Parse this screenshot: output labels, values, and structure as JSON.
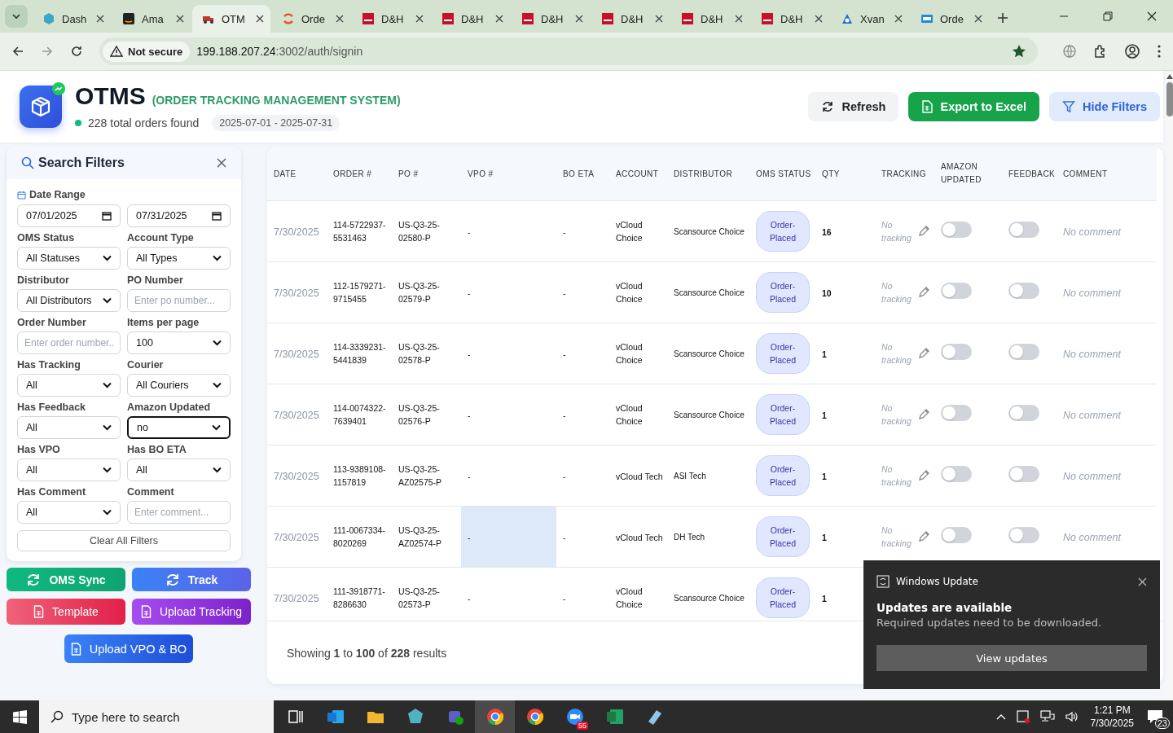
{
  "browser": {
    "tabs": [
      {
        "title": "Dash",
        "kind": "hex",
        "selected": false
      },
      {
        "title": "Ama",
        "kind": "amazon",
        "selected": false
      },
      {
        "title": "OTM",
        "kind": "truck",
        "selected": true
      },
      {
        "title": "Orde",
        "kind": "swirl",
        "selected": false
      },
      {
        "title": "D&H",
        "kind": "dh",
        "selected": false
      },
      {
        "title": "D&H",
        "kind": "dh",
        "selected": false
      },
      {
        "title": "D&H",
        "kind": "dh",
        "selected": false
      },
      {
        "title": "D&H",
        "kind": "dh",
        "selected": false
      },
      {
        "title": "D&H",
        "kind": "dh",
        "selected": false
      },
      {
        "title": "D&H",
        "kind": "dh",
        "selected": false
      },
      {
        "title": "Xvan",
        "kind": "xvan",
        "selected": false
      },
      {
        "title": "Orde",
        "kind": "ec",
        "selected": false
      }
    ],
    "security": "Not secure",
    "url_host": "199.188.207.24",
    "url_path": ":3002/auth/signin",
    "bookmarked": true
  },
  "header": {
    "title": "OTMS",
    "subtitle": "(ORDER TRACKING MANAGEMENT SYSTEM)",
    "count_text": "228 total orders found",
    "date_range": "2025-07-01 - 2025-07-31",
    "buttons": [
      {
        "label": "Refresh",
        "kind": "refresh"
      },
      {
        "label": "Export to Excel",
        "kind": "export"
      },
      {
        "label": "Hide Filters",
        "kind": "filter"
      }
    ]
  },
  "filters": {
    "title": "Search Filters",
    "date_label": "Date Range",
    "date_from": "07/01/2025",
    "date_to": "07/31/2025",
    "fields": [
      {
        "label": "OMS Status",
        "kind": "select",
        "value": "All Statuses",
        "focused": false
      },
      {
        "label": "Account Type",
        "kind": "select",
        "value": "All Types",
        "focused": false
      },
      {
        "label": "Distributor",
        "kind": "select",
        "value": "All Distributors",
        "focused": false
      },
      {
        "label": "PO Number",
        "kind": "text",
        "placeholder": "Enter po number...",
        "focused": false
      },
      {
        "label": "Order Number",
        "kind": "text",
        "placeholder": "Enter order number..",
        "focused": false
      },
      {
        "label": "Items per page",
        "kind": "select",
        "value": "100",
        "focused": false
      },
      {
        "label": "Has Tracking",
        "kind": "select",
        "value": "All",
        "focused": false
      },
      {
        "label": "Courier",
        "kind": "select",
        "value": "All Couriers",
        "focused": false
      },
      {
        "label": "Has Feedback",
        "kind": "select",
        "value": "All",
        "focused": false
      },
      {
        "label": "Amazon Updated",
        "kind": "select",
        "value": "no",
        "focused": true
      },
      {
        "label": "Has VPO",
        "kind": "select",
        "value": "All",
        "focused": false
      },
      {
        "label": "Has BO ETA",
        "kind": "select",
        "value": "All",
        "focused": false
      },
      {
        "label": "Has Comment",
        "kind": "select",
        "value": "All",
        "focused": false
      },
      {
        "label": "Comment",
        "kind": "text",
        "placeholder": "Enter comment...",
        "focused": false
      }
    ],
    "clear_button": "Clear All Filters"
  },
  "actions": [
    {
      "label": "OMS Sync",
      "kind": "sync"
    },
    {
      "label": "Track",
      "kind": "track"
    },
    {
      "label": "Template",
      "kind": "template"
    },
    {
      "label": "Upload Tracking",
      "kind": "upload_tracking"
    },
    {
      "label": "Upload VPO & BO",
      "kind": "upload_vpo"
    }
  ],
  "table": {
    "columns": [
      "DATE",
      "ORDER #",
      "PO #",
      "VPO #",
      "BO ETA",
      "ACCOUNT",
      "DISTRIBUTOR",
      "OMS STATUS",
      "QTY",
      "TRACKING",
      "AMAZON UPDATED",
      "FEEDBACK",
      "COMMENT"
    ],
    "rows": [
      {
        "date": "7/30/2025",
        "order": "114-5722937-5531463",
        "po": "US-Q3-25-02580-P",
        "vpo": "-",
        "bo_eta": "-",
        "account": "vCloud Choice",
        "distributor": "Scansource Choice",
        "status": "Order-Placed",
        "qty": "16",
        "tracking": "No tracking",
        "amazon_updated": false,
        "feedback": false,
        "comment": "No comment",
        "hovered_vpo": false
      },
      {
        "date": "7/30/2025",
        "order": "112-1579271-9715455",
        "po": "US-Q3-25-02579-P",
        "vpo": "-",
        "bo_eta": "-",
        "account": "vCloud Choice",
        "distributor": "Scansource Choice",
        "status": "Order-Placed",
        "qty": "10",
        "tracking": "No tracking",
        "amazon_updated": false,
        "feedback": false,
        "comment": "No comment",
        "hovered_vpo": false
      },
      {
        "date": "7/30/2025",
        "order": "114-3339231-5441839",
        "po": "US-Q3-25-02578-P",
        "vpo": "-",
        "bo_eta": "-",
        "account": "vCloud Choice",
        "distributor": "Scansource Choice",
        "status": "Order-Placed",
        "qty": "1",
        "tracking": "No tracking",
        "amazon_updated": false,
        "feedback": false,
        "comment": "No comment",
        "hovered_vpo": false
      },
      {
        "date": "7/30/2025",
        "order": "114-0074322-7639401",
        "po": "US-Q3-25-02576-P",
        "vpo": "-",
        "bo_eta": "-",
        "account": "vCloud Choice",
        "distributor": "Scansource Choice",
        "status": "Order-Placed",
        "qty": "1",
        "tracking": "No tracking",
        "amazon_updated": false,
        "feedback": false,
        "comment": "No comment",
        "hovered_vpo": false
      },
      {
        "date": "7/30/2025",
        "order": "113-9389108-1157819",
        "po": "US-Q3-25-AZ02575-P",
        "vpo": "-",
        "bo_eta": "-",
        "account": "vCloud Tech",
        "distributor": "ASI Tech",
        "status": "Order-Placed",
        "qty": "1",
        "tracking": "No tracking",
        "amazon_updated": false,
        "feedback": false,
        "comment": "No comment",
        "hovered_vpo": false
      },
      {
        "date": "7/30/2025",
        "order": "111-0067334-8020269",
        "po": "US-Q3-25-AZ02574-P",
        "vpo": "-",
        "bo_eta": "-",
        "account": "vCloud Tech",
        "distributor": "DH Tech",
        "status": "Order-Placed",
        "qty": "1",
        "tracking": "No tracking",
        "amazon_updated": false,
        "feedback": false,
        "comment": "No comment",
        "hovered_vpo": true
      },
      {
        "date": "7/30/2025",
        "order": "111-3918771-8286630",
        "po": "US-Q3-25-02573-P",
        "vpo": "-",
        "bo_eta": "-",
        "account": "vCloud Choice",
        "distributor": "Scansource Choice",
        "status": "Order-Placed",
        "qty": "1",
        "hovered_vpo": false
      }
    ],
    "footer": "Showing **1** to **100** of **228** results"
  },
  "toast": {
    "app": "Windows Update",
    "heading": "Updates are available",
    "body": "Required updates need to be downloaded.",
    "button": "View updates"
  },
  "taskbar": {
    "search_placeholder": "Type here to search",
    "apps": [
      {
        "kind": "taskview",
        "selected": false
      },
      {
        "kind": "outlook",
        "selected": false
      },
      {
        "kind": "folder",
        "selected": false
      },
      {
        "kind": "gem",
        "selected": false
      },
      {
        "kind": "teams",
        "selected": false
      },
      {
        "kind": "chrome",
        "selected": true
      },
      {
        "kind": "chrome",
        "selected": false
      },
      {
        "kind": "zoom",
        "badge": "55",
        "selected": false
      },
      {
        "kind": "excel",
        "selected": false
      },
      {
        "kind": "notepad",
        "selected": false
      }
    ],
    "time": "1:21 PM",
    "date": "7/30/2025",
    "notifications": "23"
  }
}
